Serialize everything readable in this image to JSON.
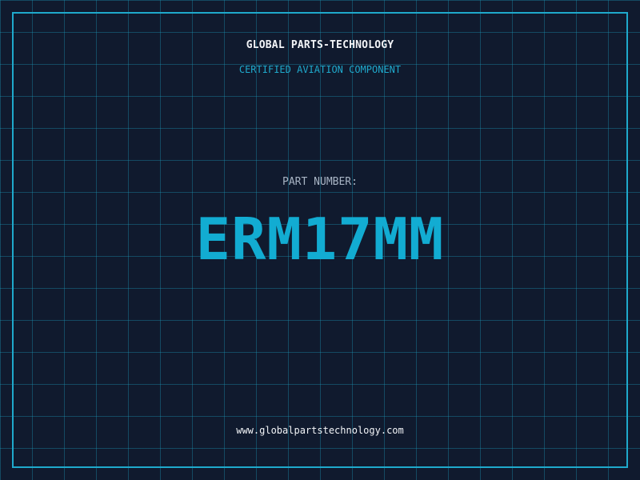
{
  "header": {
    "brand": "GLOBAL PARTS-TECHNOLOGY",
    "subtitle": "CERTIFIED AVIATION COMPONENT"
  },
  "part": {
    "label": "PART NUMBER:",
    "number": "ERM17MM"
  },
  "footer": {
    "website": "www.globalpartstechnology.com"
  },
  "colors": {
    "background": "#101a2e",
    "accent": "#1fa9cc",
    "text": "#f2f4f7",
    "muted": "#a8b4c4"
  }
}
